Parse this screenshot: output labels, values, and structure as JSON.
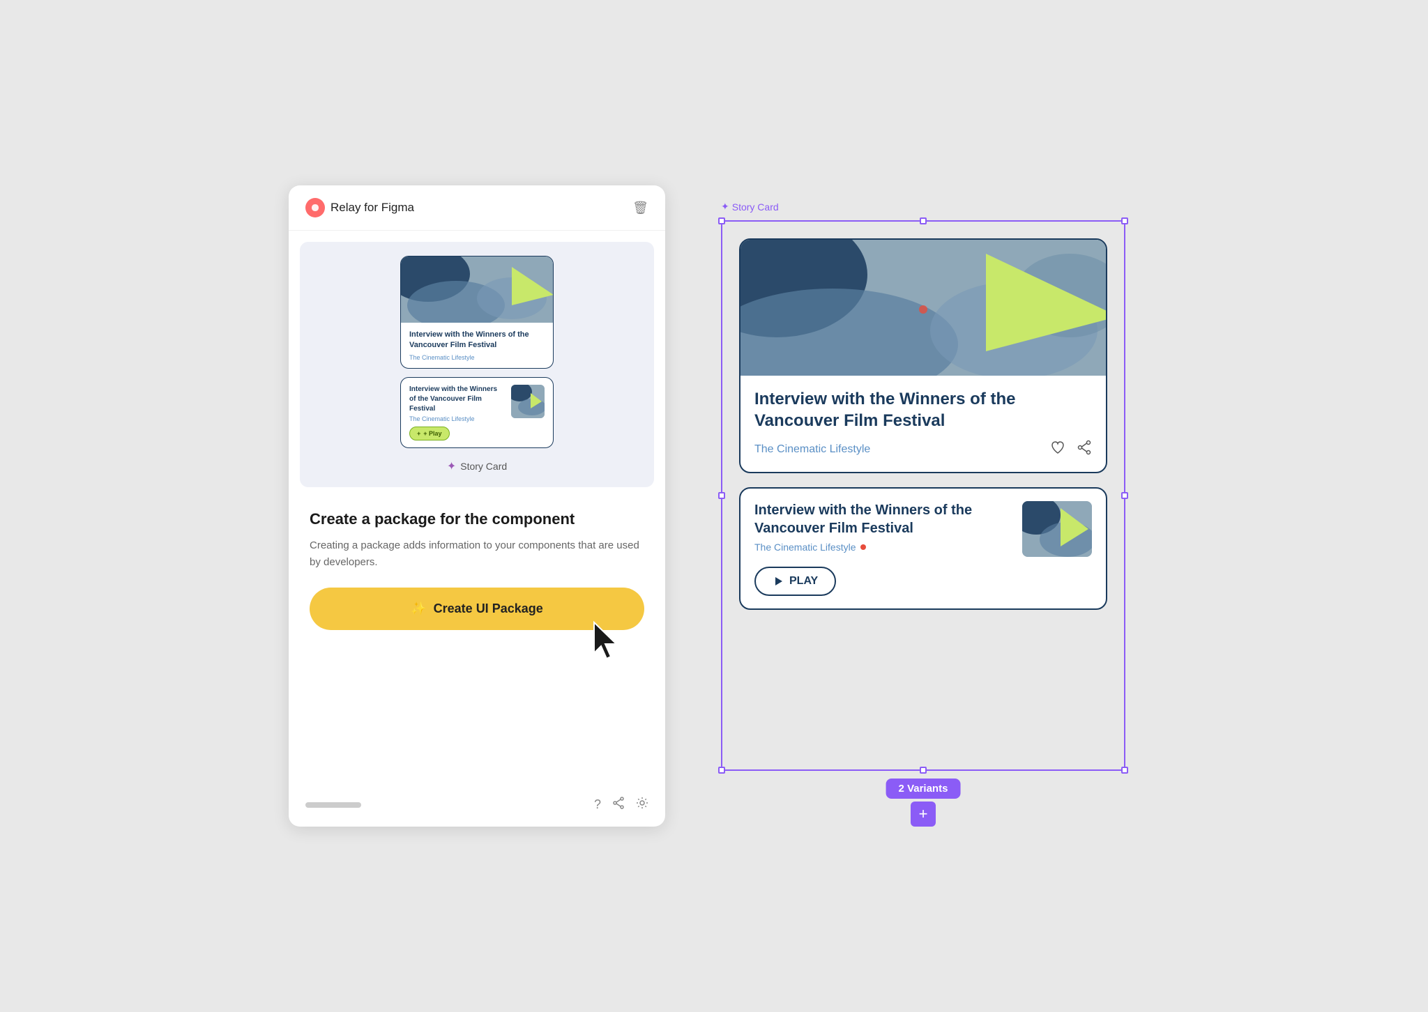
{
  "app": {
    "name": "Relay for Figma"
  },
  "left_panel": {
    "title": "Relay for Figma",
    "component_label": "Story Card",
    "main_title": "Create a package for the component",
    "description": "Creating a package adds information to your components that are used by developers.",
    "create_btn": "Create UI Package",
    "card1": {
      "title": "Interview with the Winners of the Vancouver Film Festival",
      "subtitle": "The Cinematic Lifestyle"
    },
    "card2": {
      "title": "Interview with the Winners of the Vancouver Film Festival",
      "subtitle": "The Cinematic Lifestyle",
      "play_label": "+ Play"
    }
  },
  "right_panel": {
    "selection_label": "Story Card",
    "variants_badge": "2 Variants",
    "card_large": {
      "title": "Interview with the Winners of the Vancouver Film Festival",
      "subtitle": "The Cinematic Lifestyle"
    },
    "card_small": {
      "title": "Interview with the Winners of the Vancouver Film Festival",
      "subtitle": "The Cinematic Lifestyle",
      "play_label": "PLAY"
    }
  },
  "colors": {
    "accent_purple": "#8b5cf6",
    "accent_yellow": "#f5c842",
    "navy": "#1a3a5c",
    "lime": "#c8e86a",
    "blue_sub": "#5a8fc5"
  },
  "icons": {
    "sparkle": "✦",
    "trash": "🗑",
    "help": "?",
    "share": "⬆",
    "settings": "⚙",
    "heart": "♡",
    "share2": "⬆",
    "play": "▶",
    "plus": "+"
  }
}
